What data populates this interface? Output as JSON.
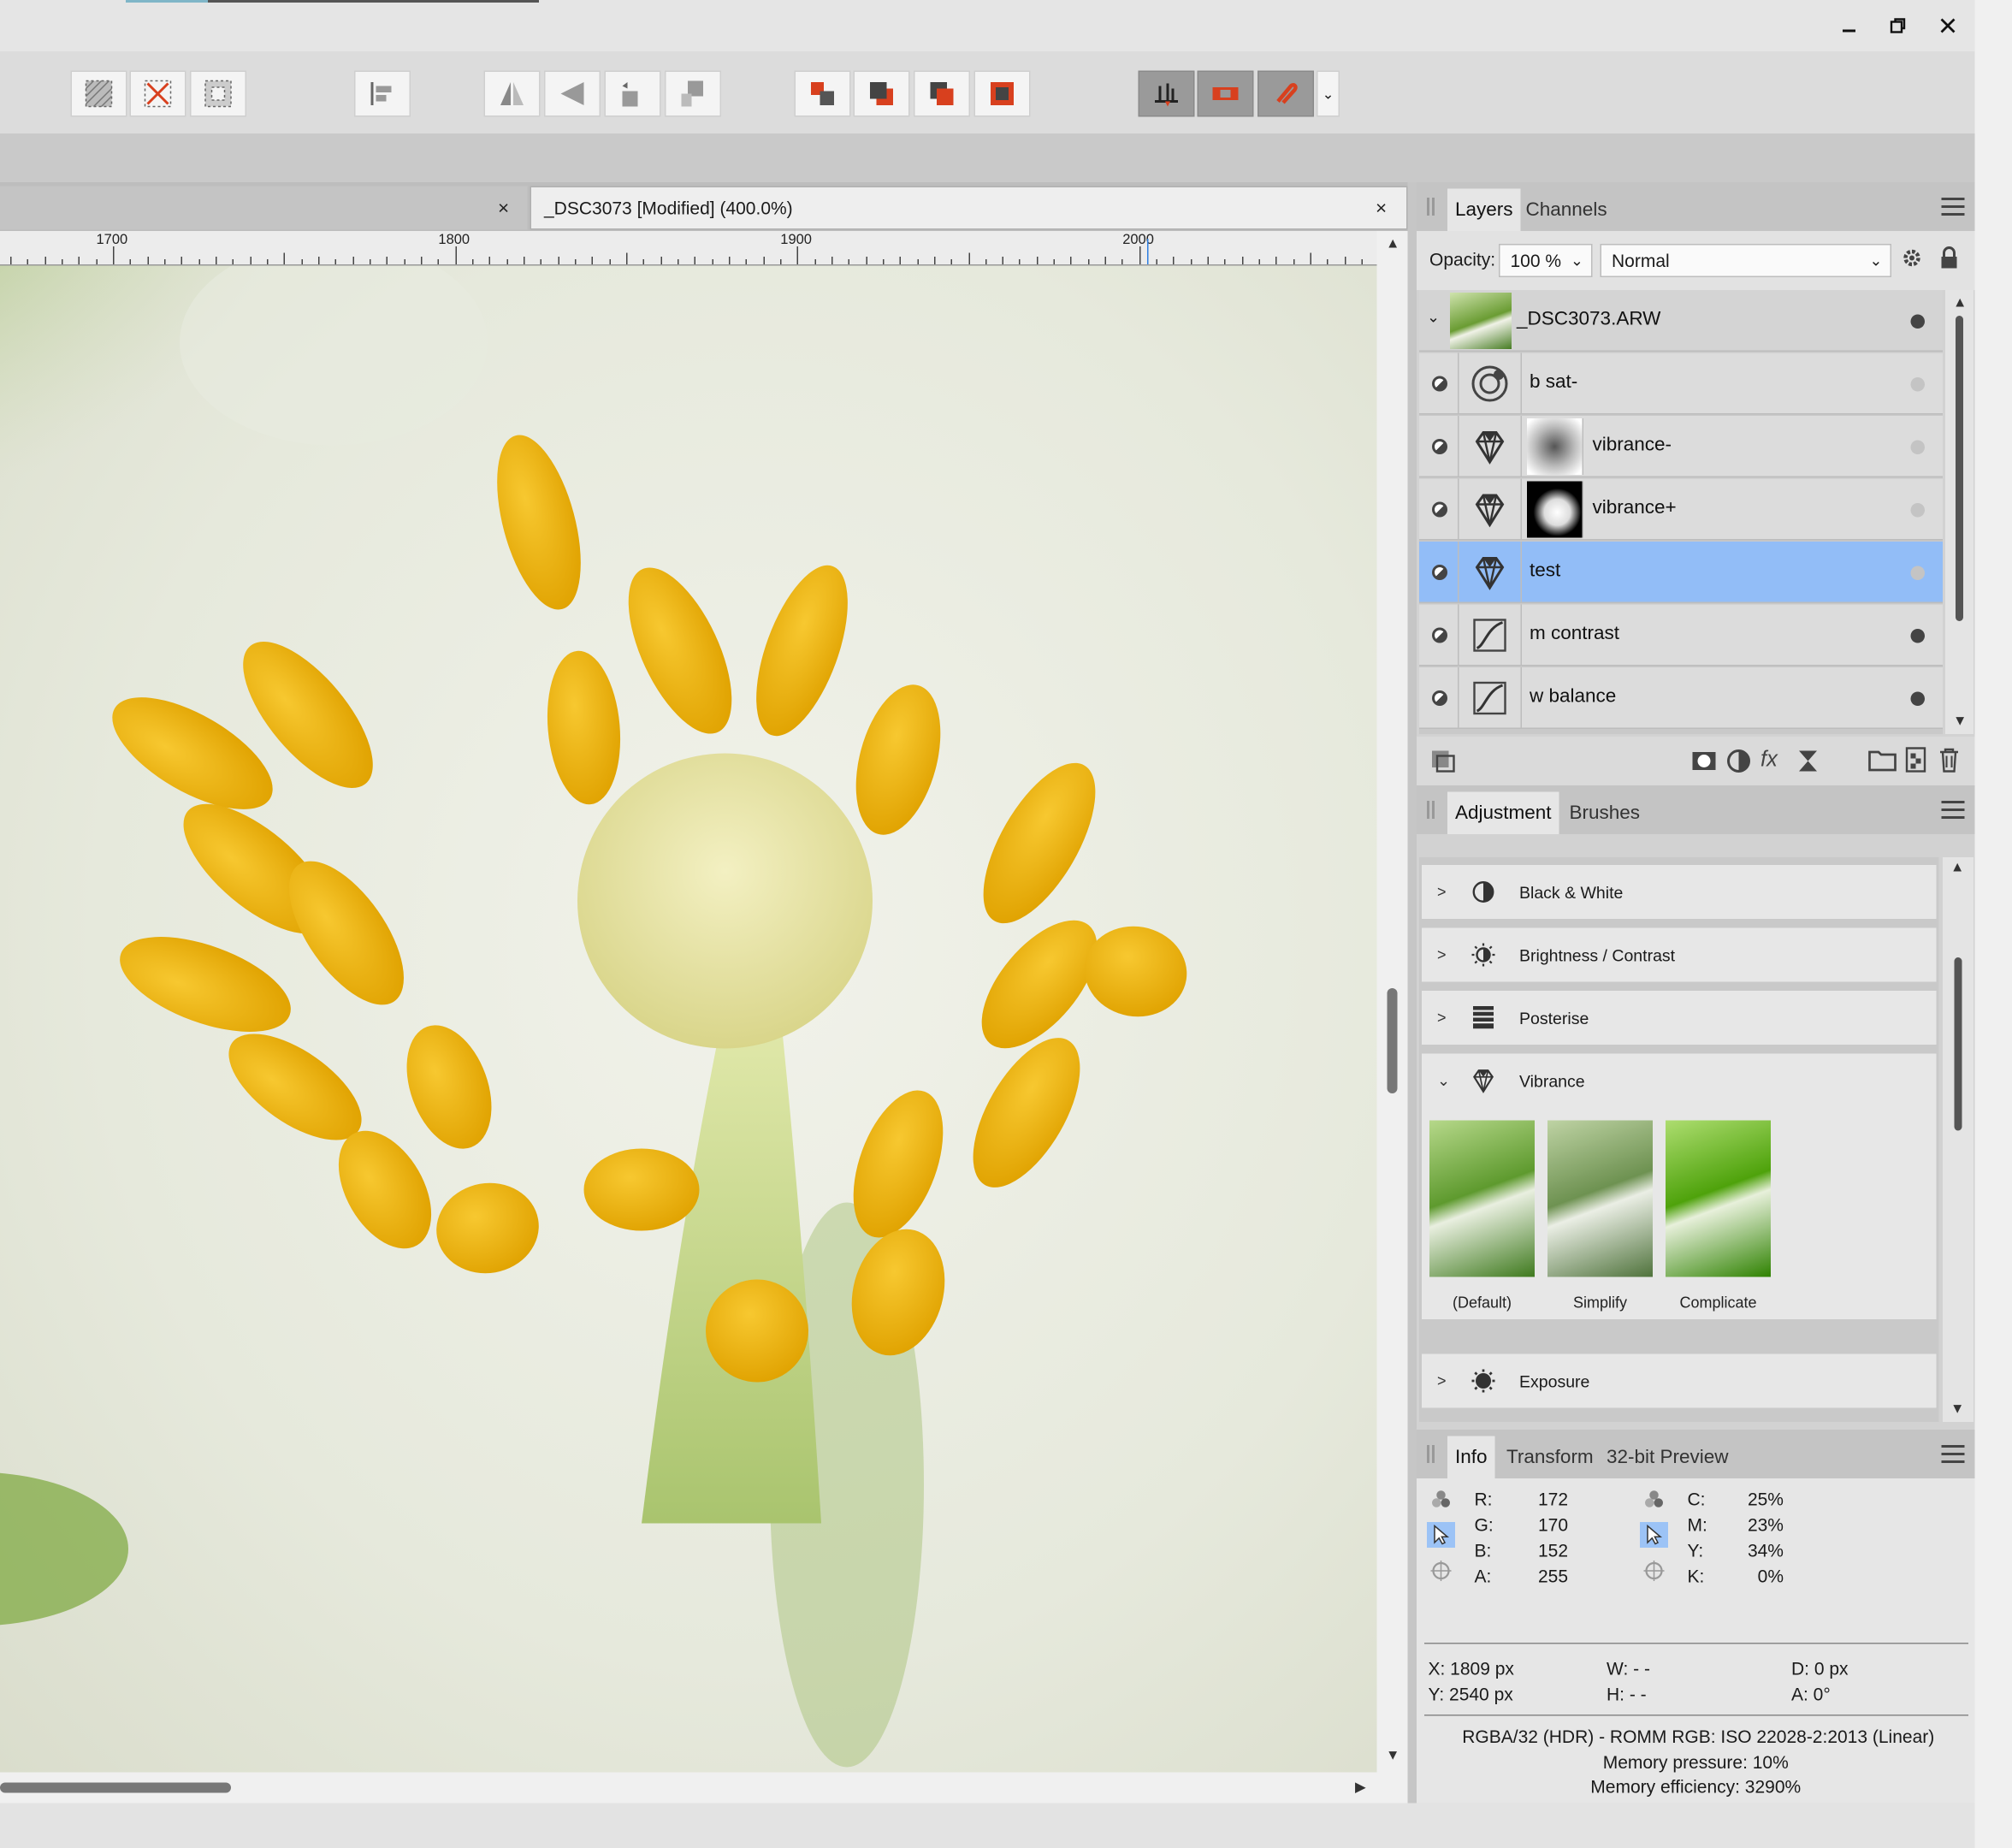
{
  "window": {
    "minimize_icon": "minimize-icon",
    "restore_icon": "restore-icon",
    "close_icon": "close-icon"
  },
  "document": {
    "inactive_tab_close": "×",
    "active_tab_title": "_DSC3073 [Modified] (400.0%)",
    "active_tab_close": "×"
  },
  "ruler": {
    "labels": [
      "1700",
      "1800",
      "1900",
      "2000"
    ]
  },
  "layers_panel": {
    "tabs": [
      "Layers",
      "Channels"
    ],
    "opacity_label": "Opacity:",
    "opacity_value": "100 %",
    "blend_mode": "Normal",
    "layers": [
      {
        "name": "_DSC3073.ARW",
        "type": "pixel-thumbnail",
        "dot": "solid"
      },
      {
        "name": "b sat-",
        "type": "hsl-icon",
        "dot": "faint"
      },
      {
        "name": "vibrance-",
        "type": "vibrance-icon",
        "dot": "faint",
        "mask": "soft"
      },
      {
        "name": "vibrance+",
        "type": "vibrance-icon",
        "dot": "faint",
        "mask": "hard"
      },
      {
        "name": "test",
        "type": "vibrance-icon",
        "dot": "faint",
        "selected": true
      },
      {
        "name": "m contrast",
        "type": "curves-icon",
        "dot": "solid"
      },
      {
        "name": "w balance",
        "type": "curves-icon",
        "dot": "solid"
      }
    ]
  },
  "adjustment_panel": {
    "tabs": [
      "Adjustment",
      "Brushes"
    ],
    "items": [
      {
        "label": "Black & White",
        "icon": "black-white-icon",
        "chevron": ">"
      },
      {
        "label": "Brightness / Contrast",
        "icon": "brightness-icon",
        "chevron": ">"
      },
      {
        "label": "Posterise",
        "icon": "posterise-icon",
        "chevron": ">"
      },
      {
        "label": "Vibrance",
        "icon": "vibrance-icon",
        "chevron": "⌄"
      },
      {
        "label": "Exposure",
        "icon": "exposure-icon",
        "chevron": ">"
      }
    ],
    "vibrance_presets": [
      "(Default)",
      "Simplify",
      "Complicate"
    ]
  },
  "info_panel": {
    "tabs": [
      "Info",
      "Transform",
      "32-bit Preview"
    ],
    "rgba": [
      {
        "label": "R:",
        "value": "172"
      },
      {
        "label": "G:",
        "value": "170"
      },
      {
        "label": "B:",
        "value": "152"
      },
      {
        "label": "A:",
        "value": "255"
      }
    ],
    "cmyk": [
      {
        "label": "C:",
        "value": "25%"
      },
      {
        "label": "M:",
        "value": "23%"
      },
      {
        "label": "Y:",
        "value": "34%"
      },
      {
        "label": "K:",
        "value": "0%"
      }
    ],
    "x": "X: 1809 px",
    "y": "Y: 2540 px",
    "w": "W: - -",
    "h": "H: - -",
    "d": "D: 0 px",
    "a": "A: 0°",
    "color_format": "RGBA/32 (HDR) - ROMM RGB: ISO 22028-2:2013 (Linear)",
    "memory_pressure": "Memory pressure: 10%",
    "memory_efficiency": "Memory efficiency: 3290%"
  },
  "colors": {
    "accent_orange": "#d8401e",
    "selection_blue": "#92bdf7",
    "ruler_cursor": "#2f7fe0"
  }
}
